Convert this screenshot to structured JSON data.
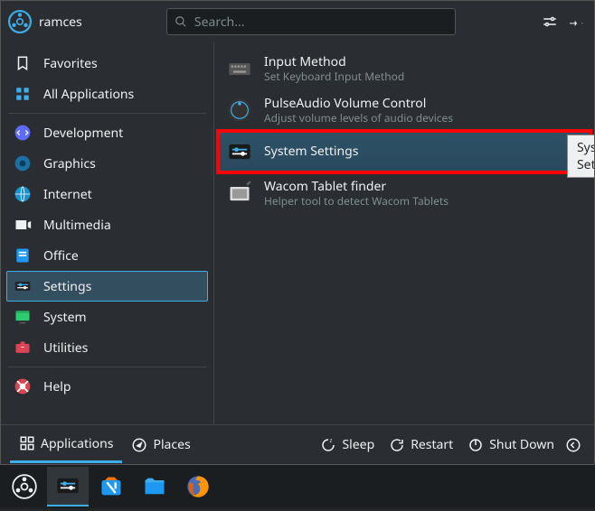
{
  "header": {
    "username": "ramces",
    "search_placeholder": "Search..."
  },
  "sidebar": {
    "favorites": "Favorites",
    "all_apps": "All Applications",
    "categories": [
      {
        "label": "Development"
      },
      {
        "label": "Graphics"
      },
      {
        "label": "Internet"
      },
      {
        "label": "Multimedia"
      },
      {
        "label": "Office"
      },
      {
        "label": "Settings"
      },
      {
        "label": "System"
      },
      {
        "label": "Utilities"
      }
    ],
    "help": "Help"
  },
  "apps": [
    {
      "title": "Input Method",
      "desc": "Set Keyboard Input Method"
    },
    {
      "title": "PulseAudio Volume Control",
      "desc": "Adjust volume levels of audio devices"
    },
    {
      "title": "System Settings",
      "desc": ""
    },
    {
      "title": "Wacom Tablet finder",
      "desc": "Helper tool to detect Wacom Tablets"
    }
  ],
  "tooltip": "System Settings",
  "footer": {
    "tabs": {
      "applications": "Applications",
      "places": "Places"
    },
    "actions": {
      "sleep": "Sleep",
      "restart": "Restart",
      "shutdown": "Shut Down"
    }
  }
}
